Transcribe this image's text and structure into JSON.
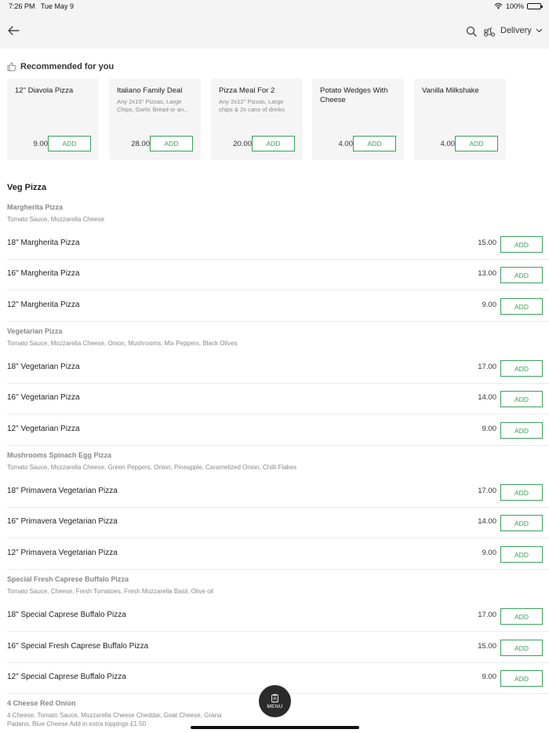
{
  "status_bar": {
    "time": "7:26 PM",
    "date": "Tue May 9",
    "battery": "100%",
    "battery_level": 1.0
  },
  "nav": {
    "back_icon": "arrow-left-icon",
    "search_icon": "search-icon",
    "delivery_icon": "scooter-icon",
    "delivery_label": "Delivery"
  },
  "recommended": {
    "title": "Recommended for you",
    "icon": "thumbs-up-icon",
    "items": [
      {
        "name": "12\" Diavola Pizza",
        "desc": "",
        "price": "9.00",
        "add": "ADD"
      },
      {
        "name": "Italiano Family Deal",
        "desc": "Any 2x16\" Pizzas, Large Chips, Garlic Bread or an...",
        "price": "28.00",
        "add": "ADD"
      },
      {
        "name": "Pizza Meal For 2",
        "desc": "Any 2x12\" Pizzas, Large chips & 2x cans of drinks",
        "price": "20.00",
        "add": "ADD"
      },
      {
        "name": "Potato Wedges With Cheese",
        "desc": "",
        "price": "4.00",
        "add": "ADD"
      },
      {
        "name": "Vanilla Milkshake",
        "desc": "",
        "price": "4.00",
        "add": "ADD"
      }
    ]
  },
  "section": {
    "title": "Veg Pizza"
  },
  "groups": [
    {
      "title": "Margherita Pizza",
      "desc": "Tomato Sauce, Mozzarella Cheese",
      "items": [
        {
          "name": "18\" Margherita Pizza",
          "price": "15.00",
          "add": "ADD"
        },
        {
          "name": "16\" Margherita Pizza",
          "price": "13.00",
          "add": "ADD"
        },
        {
          "name": "12\" Margherita Pizza",
          "price": "9.00",
          "add": "ADD"
        }
      ]
    },
    {
      "title": "Vegetarian Pizza",
      "desc": "Tomato Sauce, Mozzarella Cheese, Onion, Mushrooms, Mix Peppers. Black Olives",
      "items": [
        {
          "name": "18\" Vegetarian Pizza",
          "price": "17.00",
          "add": "ADD"
        },
        {
          "name": "16\" Vegetarian Pizza",
          "price": "14.00",
          "add": "ADD"
        },
        {
          "name": "12\" Vegetarian Pizza",
          "price": "9.00",
          "add": "ADD"
        }
      ]
    },
    {
      "title": "Mushrooms Spinach Egg Pizza",
      "desc": "Tomato Sauce, Mozzarella Cheese, Green Peppers, Onion, Pineapple, Caramelized Onion, Chilli Flakes",
      "items": [
        {
          "name": "18\" Primavera Vegetarian Pizza",
          "price": "17.00",
          "add": "ADD"
        },
        {
          "name": "16\" Primavera Vegetarian Pizza",
          "price": "14.00",
          "add": "ADD"
        },
        {
          "name": "12\" Primavera Vegetarian Pizza",
          "price": "9.00",
          "add": "ADD"
        }
      ]
    },
    {
      "title": "Special Fresh Caprese Buffalo Pizza",
      "desc": "Tomato Sauce, Cheese, Fresh Tomatoes, Fresh Mozzarella Basil, Olive oil",
      "items": [
        {
          "name": "18\" Special Caprese Buffalo Pizza",
          "price": "17.00",
          "add": "ADD"
        },
        {
          "name": "16\" Special Fresh Caprese Buffalo Pizza",
          "price": "15.00",
          "add": "ADD"
        },
        {
          "name": "12\" Special Caprese Buffalo Pizza",
          "price": "9.00",
          "add": "ADD"
        }
      ]
    },
    {
      "title": "4 Cheese Red Onion",
      "desc": "4 Cheese. Tomato Sauce, Mozzarella Cheese Cheddar, Goat Cheese, Grana Padano, Blue Cheese Add in extra toppings £1.50",
      "items": []
    }
  ],
  "menu_button": {
    "label": "MENU",
    "icon": "clipboard-icon"
  }
}
